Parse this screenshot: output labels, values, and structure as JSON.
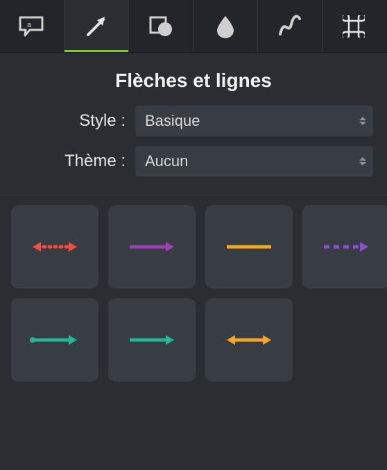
{
  "toolbar": {
    "tabs": [
      {
        "name": "callout-tab",
        "active": false
      },
      {
        "name": "arrow-tab",
        "active": true
      },
      {
        "name": "shape-tab",
        "active": false
      },
      {
        "name": "blur-tab",
        "active": false
      },
      {
        "name": "draw-tab",
        "active": false
      },
      {
        "name": "shortcuts-tab",
        "active": false
      }
    ]
  },
  "section_title": "Flèches et lignes",
  "controls": {
    "style_label": "Style :",
    "style_value": "Basique",
    "theme_label": "Thème :",
    "theme_value": "Aucun"
  },
  "swatches": [
    {
      "name": "arrow-red-double-dotted",
      "color": "#f44d3f",
      "left_head": true,
      "right_head": true,
      "dash": "dot"
    },
    {
      "name": "arrow-purple-right",
      "color": "#9b3fb5",
      "left_head": false,
      "right_head": true,
      "dash": "none"
    },
    {
      "name": "line-orange",
      "color": "#f5a623",
      "left_head": false,
      "right_head": false,
      "dash": "none"
    },
    {
      "name": "arrow-purple-dashed",
      "color": "#8a4fd0",
      "left_head": false,
      "right_head": true,
      "dash": "dash"
    },
    {
      "name": "arrow-teal-dot-start",
      "color": "#1fb89a",
      "left_head": false,
      "right_head": true,
      "dash": "none",
      "start_dot": true
    },
    {
      "name": "arrow-teal-right",
      "color": "#1fb89a",
      "left_head": false,
      "right_head": true,
      "dash": "none"
    },
    {
      "name": "arrow-orange-double",
      "color": "#f5a623",
      "left_head": true,
      "right_head": true,
      "dash": "none"
    }
  ],
  "colors": {
    "accent": "#8bc34a"
  }
}
